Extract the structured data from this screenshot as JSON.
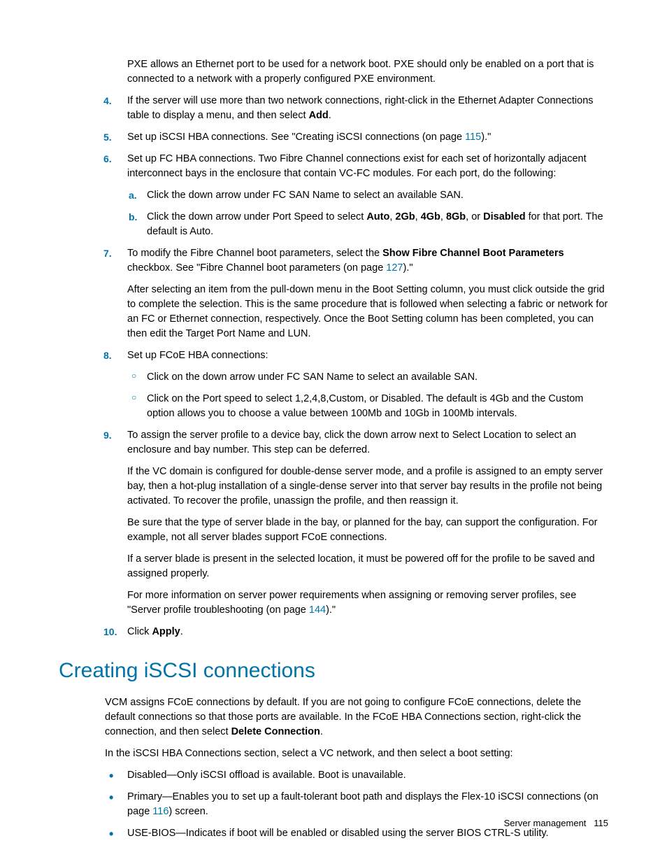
{
  "intro_pxe": "PXE allows an Ethernet port to be used for a network boot. PXE should only be enabled on a port that is connected to a network with a properly configured PXE environment.",
  "steps": {
    "s4": {
      "num": "4.",
      "a": "If the server will use more than two network connections, right-click in the Ethernet Adapter Connections table to display a menu, and then select ",
      "b": "Add",
      "c": "."
    },
    "s5": {
      "num": "5.",
      "a": "Set up iSCSI HBA connections. See \"Creating iSCSI connections (on page ",
      "link": "115",
      "b": ").\""
    },
    "s6": {
      "num": "6.",
      "text": "Set up FC HBA connections. Two Fibre Channel connections exist for each set of horizontally adjacent interconnect bays in the enclosure that contain VC-FC modules. For each port, do the following:",
      "a": {
        "m": "a.",
        "t": "Click the down arrow under FC SAN Name to select an available SAN."
      },
      "b": {
        "m": "b.",
        "p1": "Click the down arrow under Port Speed to select ",
        "b1": "Auto",
        "c1": ", ",
        "b2": "2Gb",
        "c2": ", ",
        "b3": "4Gb",
        "c3": ", ",
        "b4": "8Gb",
        "c4": ", or ",
        "b5": "Disabled",
        "p2": " for that port. The default is Auto."
      }
    },
    "s7": {
      "num": "7.",
      "a": "To modify the Fibre Channel boot parameters, select the ",
      "b": "Show Fibre Channel Boot Parameters",
      "c": " checkbox. See \"Fibre Channel boot parameters (on page ",
      "link": "127",
      "d": ").\"",
      "para": "After selecting an item from the pull-down menu in the Boot Setting column, you must click outside the grid to complete the selection. This is the same procedure that is followed when selecting a fabric or network for an FC or Ethernet connection, respectively. Once the Boot Setting column has been completed, you can then edit the Target Port Name and LUN."
    },
    "s8": {
      "num": "8.",
      "text": "Set up FCoE HBA connections:",
      "i1": "Click on the down arrow under FC SAN Name to select an available SAN.",
      "i2": "Click on the Port speed to select 1,2,4,8,Custom, or Disabled. The default is 4Gb and the Custom option allows you to choose a value between 100Mb and 10Gb in 100Mb intervals."
    },
    "s9": {
      "num": "9.",
      "text": "To assign the server profile to a device bay, click the down arrow next to Select Location to select an enclosure and bay number. This step can be deferred.",
      "p1": "If the VC domain is configured for double-dense server mode, and a profile is assigned to an empty server bay, then a hot-plug installation of a single-dense server into that server bay results in the profile not being activated. To recover the profile, unassign the profile, and then reassign it.",
      "p2": "Be sure that the type of server blade in the bay, or planned for the bay, can support the configuration. For example, not all server blades support FCoE connections.",
      "p3": "If a server blade is present in the selected location, it must be powered off for the profile to be saved and assigned properly.",
      "p4a": "For more information on server power requirements when assigning or removing server profiles, see \"Server profile troubleshooting (on page ",
      "p4link": "144",
      "p4b": ").\""
    },
    "s10": {
      "num": "10.",
      "a": "Click ",
      "b": "Apply",
      "c": "."
    }
  },
  "heading": "Creating iSCSI connections",
  "body": {
    "p1a": "VCM assigns FCoE connections by default. If you are not going to configure FCoE connections, delete the default connections so that those ports are available. In the FCoE HBA Connections section, right-click the connection, and then select ",
    "p1b": "Delete Connection",
    "p1c": ".",
    "p2": "In the iSCSI HBA Connections section, select a VC network, and then select a boot setting:",
    "b1": "Disabled—Only iSCSI offload is available. Boot is unavailable.",
    "b2a": "Primary—Enables you to set up a fault-tolerant boot path and displays the Flex-10 iSCSI connections (on page ",
    "b2link": "116",
    "b2b": ") screen.",
    "b3": "USE-BIOS—Indicates if boot will be enabled or disabled using the server BIOS CTRL-S utility."
  },
  "footer": {
    "label": "Server management",
    "page": "115"
  }
}
